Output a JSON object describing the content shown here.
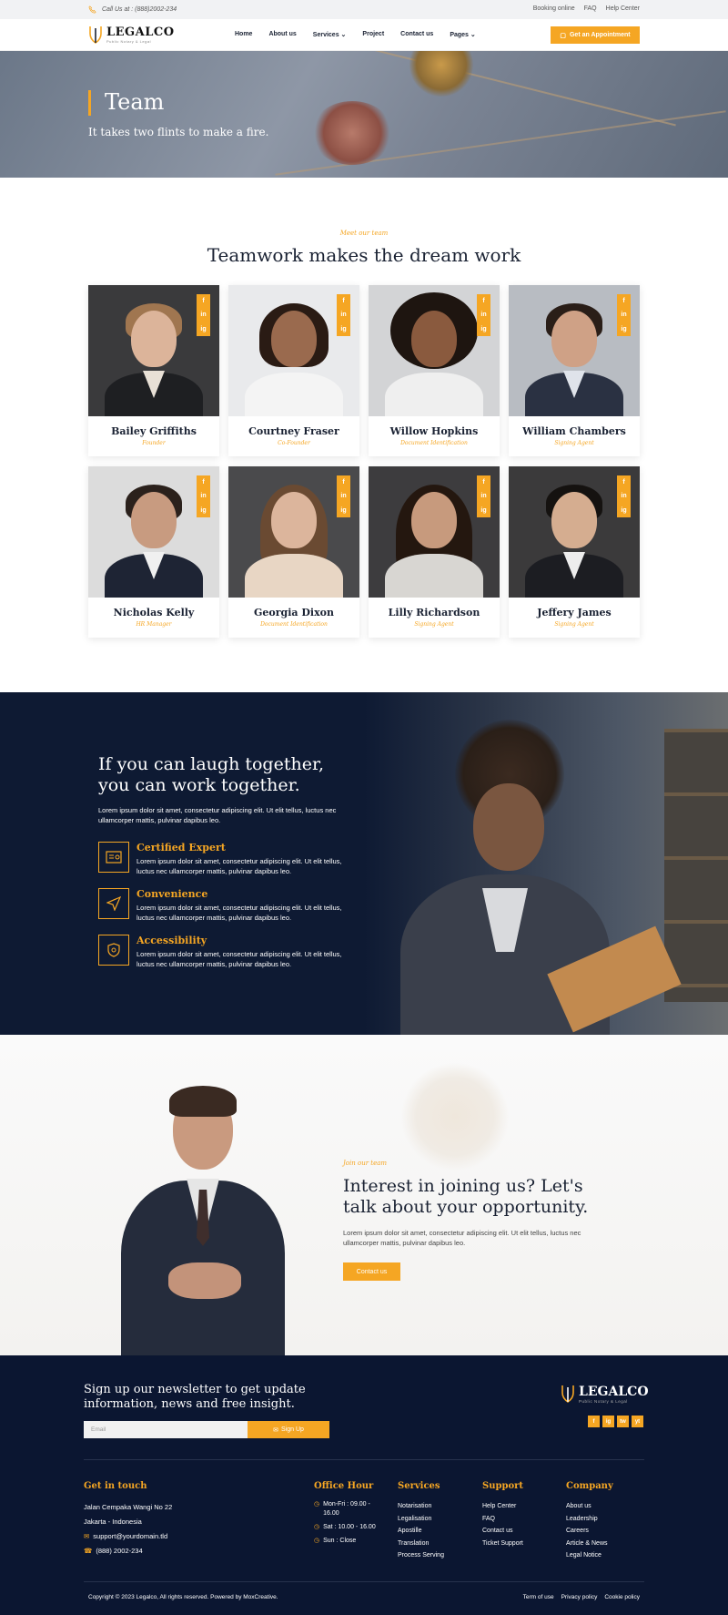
{
  "topbar": {
    "call": "Call Us at : (888)2002-234",
    "links": [
      "Booking online",
      "FAQ",
      "Help Center"
    ]
  },
  "header": {
    "brand": "LEGALCO",
    "tagline": "Public Notary & Legal",
    "nav": [
      "Home",
      "About us",
      "Services",
      "Project",
      "Contact us",
      "Pages"
    ],
    "cta": "Get an Appointment"
  },
  "hero": {
    "title": "Team",
    "subtitle": "It takes two flints to make a fire."
  },
  "team": {
    "eyebrow": "Meet our team",
    "title": "Teamwork makes the dream work",
    "members": [
      {
        "name": "Bailey Griffiths",
        "role": "Founder"
      },
      {
        "name": "Courtney Fraser",
        "role": "Co-Founder"
      },
      {
        "name": "Willow Hopkins",
        "role": "Document Identification"
      },
      {
        "name": "William Chambers",
        "role": "Signing Agent"
      },
      {
        "name": "Nicholas Kelly",
        "role": "HR Manager"
      },
      {
        "name": "Georgia Dixon",
        "role": "Document Identification"
      },
      {
        "name": "Lilly Richardson",
        "role": "Signing Agent"
      },
      {
        "name": "Jeffery James",
        "role": "Signing Agent"
      }
    ],
    "social": [
      "f",
      "in",
      "ig"
    ]
  },
  "together": {
    "title": "If you can laugh together, you can work together.",
    "lead": "Lorem ipsum dolor sit amet, consectetur adipiscing elit. Ut elit tellus, luctus nec ullamcorper mattis, pulvinar dapibus leo.",
    "features": [
      {
        "title": "Certified Expert",
        "text": "Lorem ipsum dolor sit amet, consectetur adipiscing elit. Ut elit tellus, luctus nec ullamcorper mattis, pulvinar dapibus leo.",
        "icon": "certificate-icon"
      },
      {
        "title": "Convenience",
        "text": "Lorem ipsum dolor sit amet, consectetur adipiscing elit. Ut elit tellus, luctus nec ullamcorper mattis, pulvinar dapibus leo.",
        "icon": "paper-plane-icon"
      },
      {
        "title": "Accessibility",
        "text": "Lorem ipsum dolor sit amet, consectetur adipiscing elit. Ut elit tellus, luctus nec ullamcorper mattis, pulvinar dapibus leo.",
        "icon": "shield-icon"
      }
    ]
  },
  "join": {
    "eyebrow": "Join our team",
    "title": "Interest in joining us? Let's talk about your opportunity.",
    "text": "Lorem ipsum dolor sit amet, consectetur adipiscing elit. Ut elit tellus, luctus nec ullamcorper mattis, pulvinar dapibus leo.",
    "button": "Contact us"
  },
  "footer": {
    "newsletter": "Sign up our newsletter to get update information, news and free insight.",
    "email_placeholder": "Email",
    "signup": "Sign Up",
    "brand": "LEGALCO",
    "tagline": "Public Notary & Legal",
    "social": [
      "f",
      "ig",
      "tw",
      "yt"
    ],
    "contact": {
      "title": "Get in touch",
      "address1": "Jalan Cempaka Wangi No 22",
      "address2": "Jakarta - Indonesia",
      "email": "support@yourdomain.tld",
      "phone": "(888) 2002-234"
    },
    "hours": {
      "title": "Office Hour",
      "items": [
        "Mon-Fri : 09.00 - 16.00",
        "Sat : 10.00 - 16.00",
        "Sun : Close"
      ]
    },
    "services": {
      "title": "Services",
      "items": [
        "Notarisation",
        "Legalisation",
        "Apostille",
        "Translation",
        "Process Serving"
      ]
    },
    "support": {
      "title": "Support",
      "items": [
        "Help Center",
        "FAQ",
        "Contact us",
        "Ticket Support"
      ]
    },
    "company": {
      "title": "Company",
      "items": [
        "About us",
        "Leadership",
        "Careers",
        "Article & News",
        "Legal Notice"
      ]
    },
    "copyright": "Copyright © 2023 Legalco, All rights reserved. Powered by MoxCreative.",
    "legal": [
      "Term of use",
      "Privacy policy",
      "Cookie policy"
    ]
  },
  "colors": {
    "accent": "#f5a623",
    "navy": "#0e1a33"
  }
}
